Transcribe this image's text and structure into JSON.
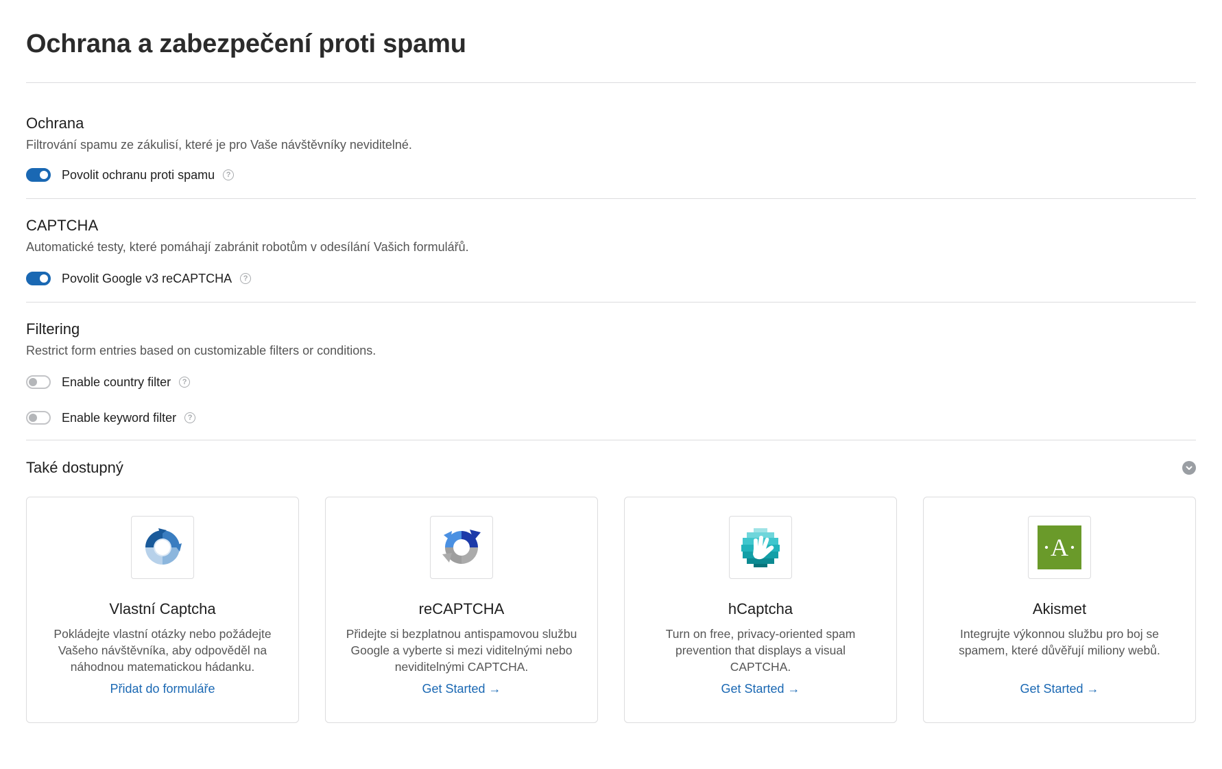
{
  "page": {
    "title": "Ochrana a zabezpečení proti spamu"
  },
  "sections": [
    {
      "title": "Ochrana",
      "desc": "Filtrování spamu ze zákulisí, které je pro Vaše návštěvníky neviditelné.",
      "toggles": [
        {
          "label": "Povolit ochranu proti spamu",
          "on": true
        }
      ]
    },
    {
      "title": "CAPTCHA",
      "desc": "Automatické testy, které pomáhají zabránit robotům v odesílání Vašich formulářů.",
      "toggles": [
        {
          "label": "Povolit Google v3 reCAPTCHA",
          "on": true
        }
      ]
    },
    {
      "title": "Filtering",
      "desc": "Restrict form entries based on customizable filters or conditions.",
      "toggles": [
        {
          "label": "Enable country filter",
          "on": false
        },
        {
          "label": "Enable keyword filter",
          "on": false
        }
      ]
    }
  ],
  "help_glyph": "?",
  "also": {
    "title": "Také dostupný",
    "cards": [
      {
        "title": "Vlastní Captcha",
        "desc": "Pokládejte vlastní otázky nebo požádejte Vašeho návštěvníka, aby odpověděl na náhodnou matematickou hádanku.",
        "link": "Přidat do formuláře",
        "icon": "custom-captcha-icon"
      },
      {
        "title": "reCAPTCHA",
        "desc": "Přidejte si bezplatnou antispamovou službu Google a vyberte si mezi viditelnými nebo neviditelnými CAPTCHA.",
        "link": "Get Started →",
        "icon": "recaptcha-icon"
      },
      {
        "title": "hCaptcha",
        "desc": "Turn on free, privacy-oriented spam prevention that displays a visual CAPTCHA.",
        "link": "Get Started →",
        "icon": "hcaptcha-icon"
      },
      {
        "title": "Akismet",
        "desc": "Integrujte výkonnou službu pro boj se spamem, které důvěřují miliony webů.",
        "link": "Get Started →",
        "icon": "akismet-icon",
        "logo_text": "·A·"
      }
    ]
  },
  "colors": {
    "accent": "#1a68b3",
    "akismet": "#6a9a2a",
    "hcaptcha": "#2bbbc4"
  }
}
